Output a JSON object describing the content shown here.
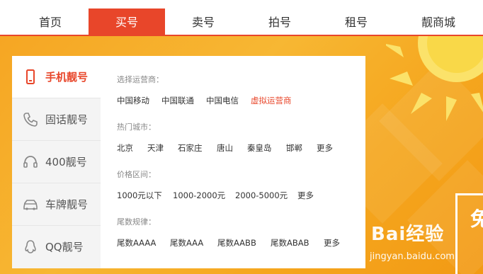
{
  "nav": {
    "tabs": [
      {
        "label": "首页"
      },
      {
        "label": "买号",
        "active": true
      },
      {
        "label": "卖号"
      },
      {
        "label": "拍号"
      },
      {
        "label": "租号"
      },
      {
        "label": "靓商城"
      }
    ]
  },
  "sidebar": {
    "items": [
      {
        "label": "手机靓号",
        "icon": "mobile-phone-icon",
        "active": true
      },
      {
        "label": "固话靓号",
        "icon": "landline-phone-icon"
      },
      {
        "label": "400靓号",
        "icon": "headset-icon"
      },
      {
        "label": "车牌靓号",
        "icon": "car-icon"
      },
      {
        "label": "QQ靓号",
        "icon": "qq-penguin-icon"
      }
    ]
  },
  "filters": {
    "carrier": {
      "title": "选择运营商：",
      "options": [
        "中国移动",
        "中国联通",
        "中国电信",
        "虚拟运营商"
      ]
    },
    "city": {
      "title": "热门城市：",
      "options": [
        "北京",
        "天津",
        "石家庄",
        "唐山",
        "秦皇岛",
        "邯郸",
        "更多"
      ]
    },
    "price": {
      "title": "价格区间：",
      "options": [
        "1000元以下",
        "1000-2000元",
        "2000-5000元",
        "更多"
      ]
    },
    "pattern": {
      "title": "尾数规律：",
      "options": [
        "尾数AAAA",
        "尾数AAA",
        "尾数AABB",
        "尾数ABAB",
        "更多"
      ]
    }
  },
  "banner": {
    "promo_text": "免"
  },
  "watermark": {
    "logo": "Bai经验",
    "url": "jingyan.baidu.com"
  },
  "colors": {
    "accent": "#e8462a",
    "banner": "#f6a623"
  }
}
